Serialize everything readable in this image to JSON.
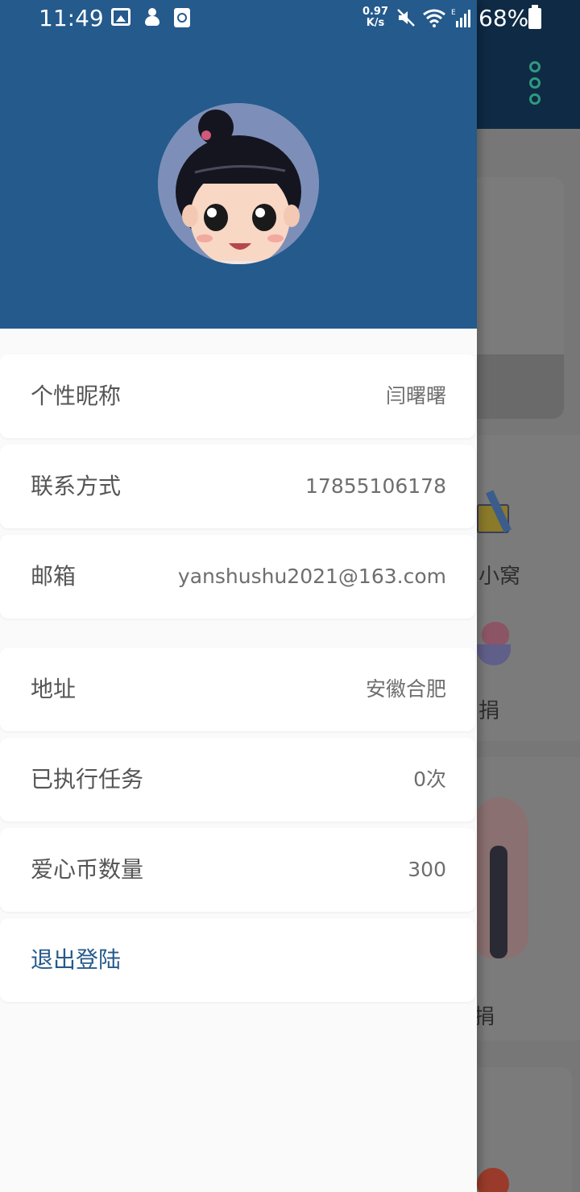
{
  "status_bar": {
    "time": "11:49",
    "net_speed_value": "0.97",
    "net_speed_unit": "K/s",
    "battery_text": "68%"
  },
  "drawer": {
    "rows": [
      {
        "label": "个性昵称",
        "value": "闫曙曙"
      },
      {
        "label": "联系方式",
        "value": "17855106178"
      },
      {
        "label": "邮箱",
        "value": "yanshushu2021@163.com"
      },
      {
        "label": "地址",
        "value": "安徽合肥"
      },
      {
        "label": "已执行任务",
        "value": "0次"
      },
      {
        "label": "爱心币数量",
        "value": "300"
      }
    ],
    "logout_label": "退出登陆"
  },
  "background_app": {
    "label_1": "小窝",
    "label_2": "捐",
    "label_3": "捐"
  },
  "colors": {
    "header_blue": "#245a8c",
    "toolbar_dark": "#0f2a45",
    "logout_text": "#245a8c"
  }
}
